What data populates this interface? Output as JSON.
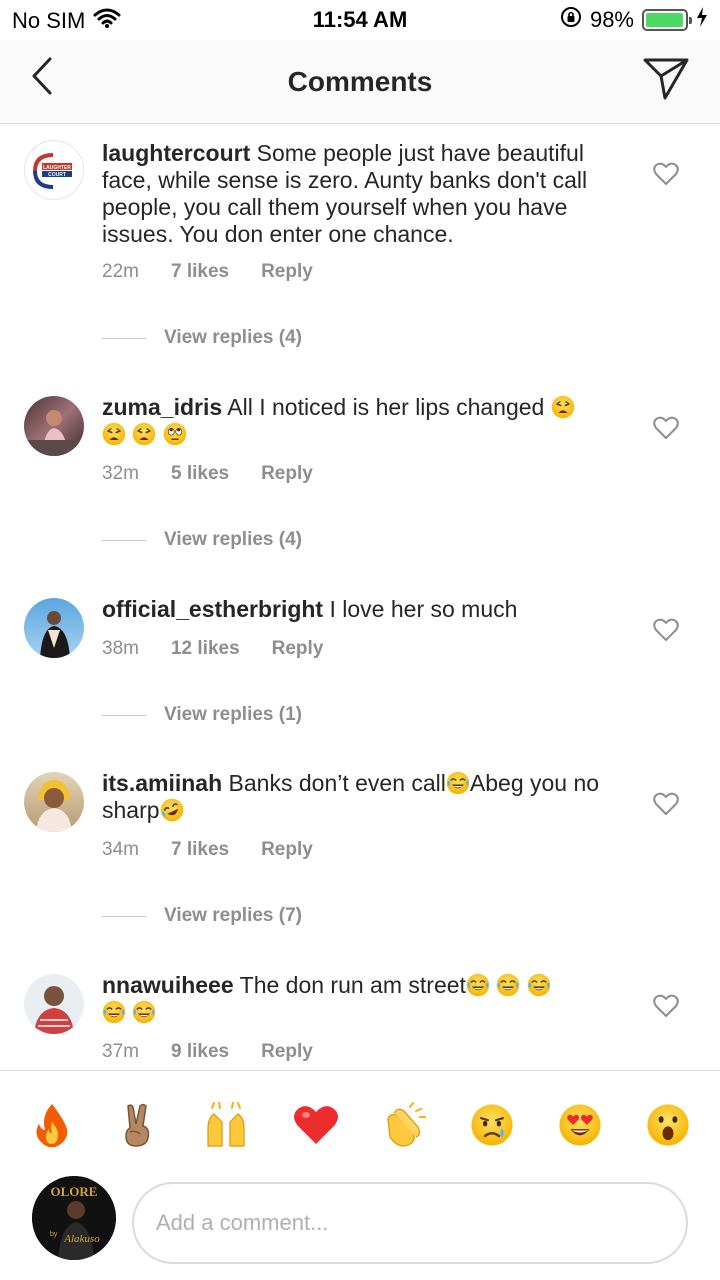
{
  "status_bar": {
    "carrier": "No SIM",
    "time": "11:54 AM",
    "battery_percent": "98%",
    "battery_level": 0.98,
    "icons": [
      "wifi-icon",
      "rotation-lock-icon",
      "battery-icon",
      "charging-icon"
    ]
  },
  "header": {
    "title": "Comments",
    "back_icon": "chevron-left-icon",
    "send_icon": "paper-plane-icon"
  },
  "comments": [
    {
      "username": "laughtercourt",
      "text": "Some people just have beautiful face, while sense is zero. Aunty banks don't call people,  you call them yourself when you have issues. You don enter one chance.",
      "time": "22m",
      "likes": "7 likes",
      "reply": "Reply",
      "view_replies": "View replies (4)",
      "avatar_text": "LAUGHTER COURT"
    },
    {
      "username": "zuma_idris",
      "text": "All I noticed is her lips changed",
      "emojis": [
        "weary",
        "weary",
        "weary",
        "rolling-eyes"
      ],
      "time": "32m",
      "likes": "5 likes",
      "reply": "Reply",
      "view_replies": "View replies (4)"
    },
    {
      "username": "official_estherbright",
      "text": "I love her so much",
      "time": "38m",
      "likes": "12 likes",
      "reply": "Reply",
      "view_replies": "View replies (1)"
    },
    {
      "username": "its.amiinah",
      "text_a": "Banks don’t even call",
      "text_b": "Abeg you no sharp",
      "emojis": [
        "tears-of-joy",
        "rofl"
      ],
      "time": "34m",
      "likes": "7 likes",
      "reply": "Reply",
      "view_replies": "View replies (7)"
    },
    {
      "username": "nnawuiheee",
      "text": "The don run am street",
      "emojis": [
        "tears-of-joy",
        "tears-of-joy",
        "tears-of-joy",
        "tears-of-joy",
        "tears-of-joy"
      ],
      "time": "37m",
      "likes": "9 likes",
      "reply": "Reply"
    }
  ],
  "emoji_bar": [
    "fire",
    "victory-hand",
    "raising-hands",
    "red-heart",
    "clapping-hands",
    "crying-face",
    "heart-eyes",
    "open-mouth"
  ],
  "composer": {
    "placeholder": "Add a comment...",
    "avatar_text": "OLORE",
    "avatar_sub": "by",
    "avatar_script": "Alakuso"
  },
  "colors": {
    "text": "#262626",
    "secondary": "#8e8e8e",
    "divider": "#dbdbdb",
    "battery": "#4cd964",
    "heart_red": "#ed2d2d"
  }
}
